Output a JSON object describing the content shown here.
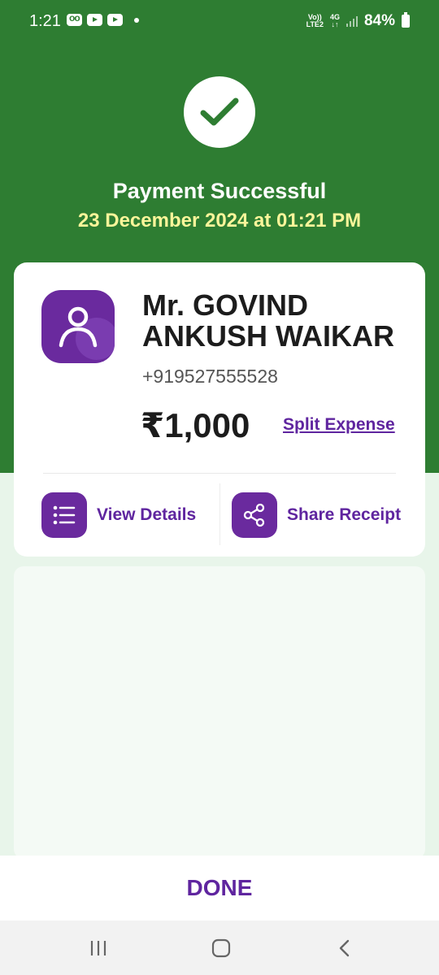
{
  "status_bar": {
    "time": "1:21",
    "network_top": "Vo))",
    "network_bottom": "LTE2",
    "data_top": "4G",
    "data_bottom": "↓↑",
    "battery": "84%"
  },
  "header": {
    "title": "Payment Successful",
    "date": "23 December 2024 at 01:21 PM"
  },
  "payee": {
    "name": "Mr. GOVIND ANKUSH WAIKAR",
    "phone": "+919527555528",
    "amount": "₹1,000",
    "split_label": "Split Expense"
  },
  "actions": {
    "details_label": "View Details",
    "share_label": "Share Receipt"
  },
  "footer": {
    "done_label": "DONE"
  },
  "colors": {
    "header_green": "#2e7d32",
    "brand_purple": "#5f259f",
    "date_yellow": "#fbf59a"
  },
  "icons": {
    "check": "check-icon",
    "avatar": "person-icon",
    "details": "list-icon",
    "share": "share-icon"
  }
}
